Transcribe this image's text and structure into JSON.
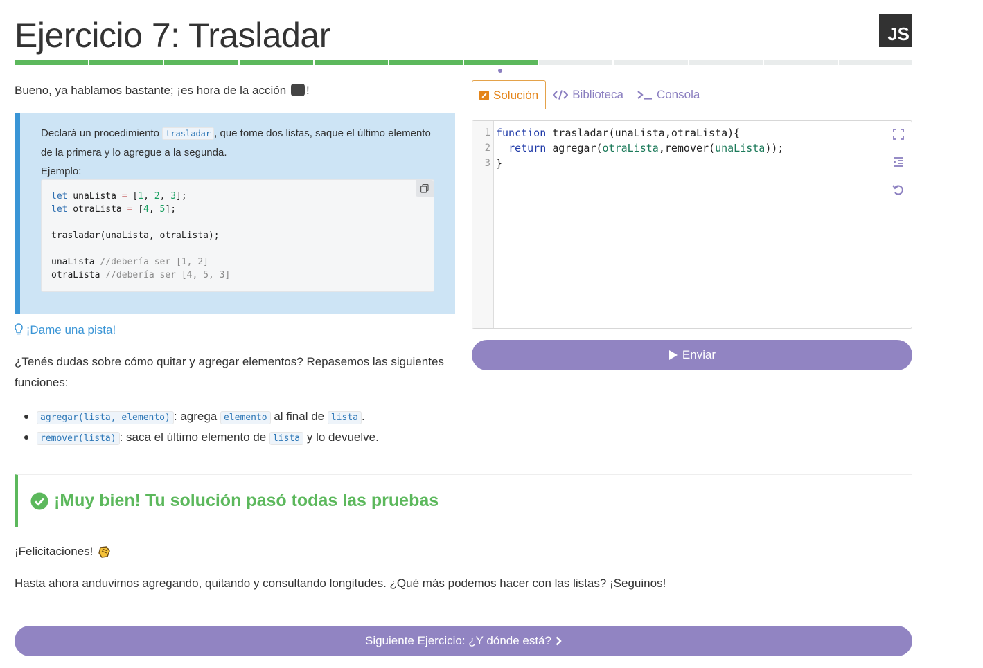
{
  "header": {
    "title": "Ejercicio 7: Trasladar",
    "language_badge": "JS"
  },
  "progress": {
    "total_segments": 12,
    "completed_segments": 7,
    "current_index": 7
  },
  "intro": {
    "text_before": "Bueno, ya hablamos bastante; ¡es hora de la acción",
    "emoji": "movie-camera-icon",
    "text_after": "!"
  },
  "task": {
    "p1_before": "Declará un procedimiento",
    "p1_code": "trasladar",
    "p1_after": ", que tome dos listas, saque el último elemento de la primera y lo agregue a la segunda.",
    "example_label": "Ejemplo:",
    "code": {
      "l1_kw": "let",
      "l1_var": " unaLista ",
      "l1_op": "=",
      "l1_a": " [",
      "l1_n1": "1",
      "l1_b": ", ",
      "l1_n2": "2",
      "l1_c": ", ",
      "l1_n3": "3",
      "l1_d": "];",
      "l2_kw": "let",
      "l2_var": " otraLista ",
      "l2_op": "=",
      "l2_a": " [",
      "l2_n1": "4",
      "l2_b": ", ",
      "l2_n2": "5",
      "l2_d": "];",
      "l4": "trasladar(unaLista, otraLista);",
      "l6_code": "unaLista ",
      "l6_comment": "//debería ser [1, 2]",
      "l7_code": "otraLista ",
      "l7_comment": "//debería ser [4, 5, 3]"
    }
  },
  "hint": {
    "label": "¡Dame una pista!"
  },
  "doubts": {
    "text": "¿Tenés dudas sobre cómo quitar y agregar elementos? Repasemos las siguientes funciones:"
  },
  "functions": [
    {
      "code": "agregar(lista, elemento)",
      "t1": ": agrega",
      "c2": "elemento",
      "t2": "al final de",
      "c3": "lista",
      "t3": "."
    },
    {
      "code": "remover(lista)",
      "t1": ": saca el último elemento de",
      "c2": "lista",
      "t2": "y lo devuelve."
    }
  ],
  "tabs": [
    {
      "label": "Solución",
      "active": true
    },
    {
      "label": "Biblioteca",
      "active": false
    },
    {
      "label": "Consola",
      "active": false
    }
  ],
  "editor": {
    "line_numbers": [
      "1",
      "2",
      "3"
    ],
    "line1_kw": "function",
    "line1_rest": " trasladar(unaLista,otraLista){",
    "line2_indent": "  ",
    "line2_kw": "return",
    "line2_a": " agregar(",
    "line2_var1": "otraLista",
    "line2_b": ",remover(",
    "line2_var2": "unaLista",
    "line2_c": "));",
    "line3": "}"
  },
  "submit": {
    "label": "Enviar"
  },
  "result": {
    "message": "¡Muy bien! Tu solución pasó todas las pruebas"
  },
  "congrats": {
    "text": "¡Felicitaciones!"
  },
  "closing": {
    "text": "Hasta ahora anduvimos agregando, quitando y consultando longitudes. ¿Qué más podemos hacer con las listas? ¡Seguinos!"
  },
  "next": {
    "label": "Siguiente Ejercicio: ¿Y dónde está?"
  },
  "colors": {
    "accent_purple": "#9184c2",
    "success_green": "#5cb85c",
    "info_blue": "#3a95d6",
    "active_tab_orange": "#e4851a"
  }
}
